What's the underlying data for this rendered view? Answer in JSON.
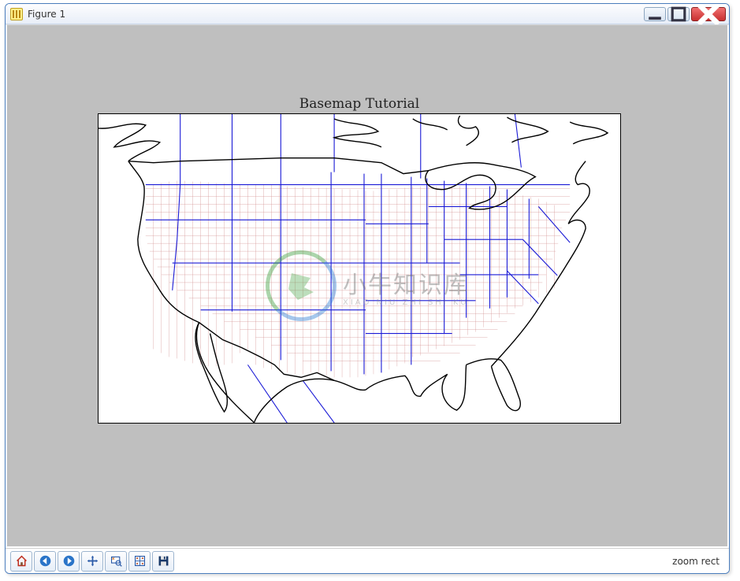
{
  "window": {
    "title": "Figure 1"
  },
  "plot": {
    "title": "Basemap Tutorial"
  },
  "watermark": {
    "main": "小牛知识库",
    "sub": "XIAO NIU ZHI SHI KU"
  },
  "toolbar": {
    "home_tip": "Home",
    "back_tip": "Back",
    "forward_tip": "Forward",
    "pan_tip": "Pan",
    "zoom_tip": "Zoom",
    "subplots_tip": "Configure subplots",
    "save_tip": "Save"
  },
  "status": {
    "text": "zoom rect"
  },
  "chart_data": {
    "type": "map",
    "title": "Basemap Tutorial",
    "projection": "merc",
    "region": "United States (contiguous + parts of southern Canada and northern Mexico)",
    "approx_extent": {
      "lon_min": -130,
      "lon_max": -60,
      "lat_min": 22,
      "lat_max": 53
    },
    "layers": [
      {
        "name": "coastlines",
        "stroke": "#000000"
      },
      {
        "name": "countries",
        "stroke": "#000000"
      },
      {
        "name": "US states",
        "stroke": "#0000d0"
      },
      {
        "name": "US counties",
        "stroke": "#cc8080"
      }
    ]
  }
}
